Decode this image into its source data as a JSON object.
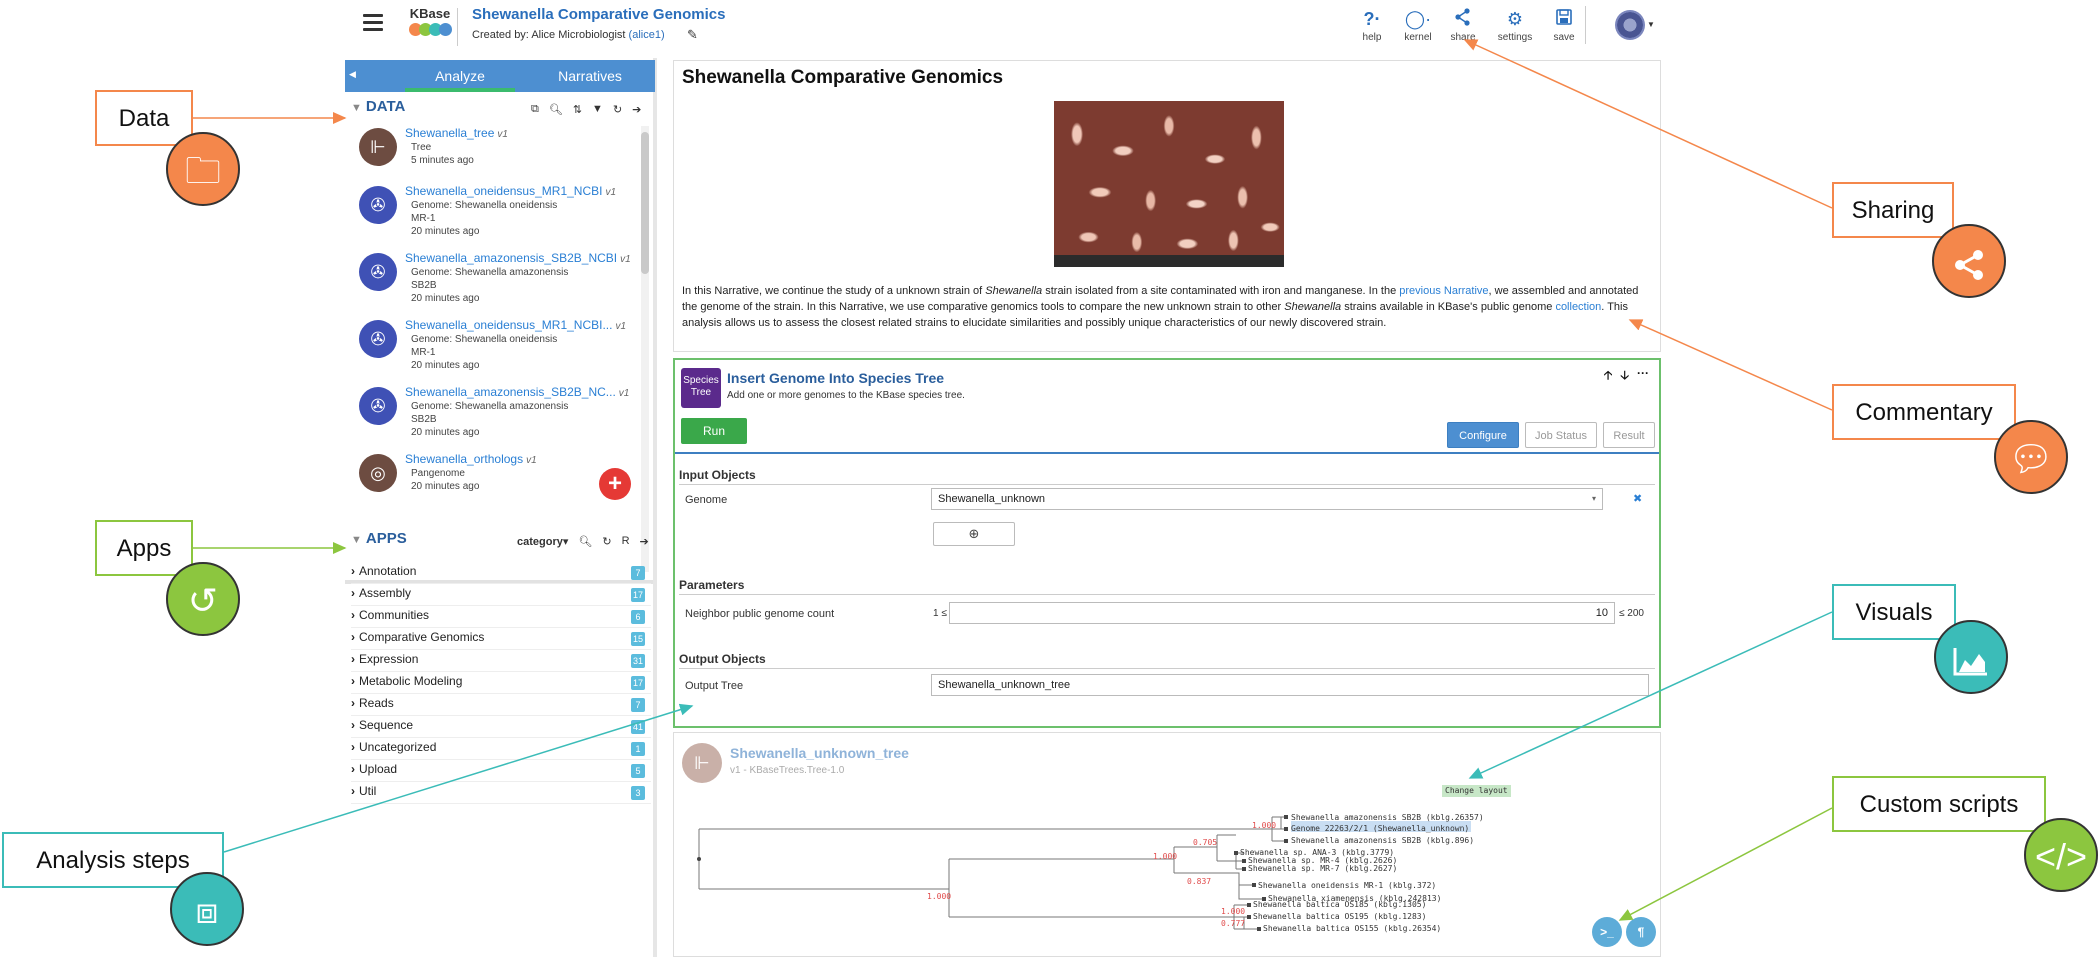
{
  "header": {
    "logo_text": "KBase",
    "title": "Shewanella Comparative Genomics",
    "created_by_label": "Created by:",
    "creator_name": "Alice Microbiologist",
    "creator_user": "(alice1)",
    "buttons": [
      {
        "label": "help",
        "icon": "question-icon"
      },
      {
        "label": "kernel",
        "icon": "kernel-icon"
      },
      {
        "label": "share",
        "icon": "share-icon"
      },
      {
        "label": "settings",
        "icon": "gear-icon"
      },
      {
        "label": "save",
        "icon": "save-icon"
      }
    ]
  },
  "sidebar": {
    "tabs": [
      "Analyze",
      "Narratives"
    ],
    "data_header": "DATA",
    "data_items": [
      {
        "name": "Shewanella_tree",
        "version": "v1",
        "type": "Tree",
        "subtitle": "",
        "time": "5 minutes ago",
        "icon": "tree-icon",
        "color": "#6d4c41"
      },
      {
        "name": "Shewanella_oneidensus_MR1_NCBI",
        "version": "v1",
        "type": "Genome: Shewanella oneidensis",
        "subtitle": "MR-1",
        "time": "20 minutes ago",
        "icon": "dna-icon",
        "color": "#3f51b5"
      },
      {
        "name": "Shewanella_amazonensis_SB2B_NCBI",
        "version": "v1",
        "type": "Genome: Shewanella amazonensis",
        "subtitle": "SB2B",
        "time": "20 minutes ago",
        "icon": "dna-icon",
        "color": "#3f51b5"
      },
      {
        "name": "Shewanella_oneidensus_MR1_NCBI...",
        "version": "v1",
        "type": "Genome: Shewanella oneidensis",
        "subtitle": "MR-1",
        "time": "20 minutes ago",
        "icon": "dna-icon",
        "color": "#3f51b5"
      },
      {
        "name": "Shewanella_amazonensis_SB2B_NC...",
        "version": "v1",
        "type": "Genome: Shewanella amazonensis",
        "subtitle": "SB2B",
        "time": "20 minutes ago",
        "icon": "dna-icon",
        "color": "#3f51b5"
      },
      {
        "name": "Shewanella_orthologs",
        "version": "v1",
        "type": "Pangenome",
        "subtitle": "",
        "time": "20 minutes ago",
        "icon": "pangenome-icon",
        "color": "#6d4c41"
      }
    ],
    "apps_header": "APPS",
    "apps_category_label": "category",
    "apps_filter_label": "R",
    "app_categories": [
      {
        "label": "Annotation",
        "count": "7"
      },
      {
        "label": "Assembly",
        "count": "17"
      },
      {
        "label": "Communities",
        "count": "6"
      },
      {
        "label": "Comparative Genomics",
        "count": "15"
      },
      {
        "label": "Expression",
        "count": "31"
      },
      {
        "label": "Metabolic Modeling",
        "count": "17"
      },
      {
        "label": "Reads",
        "count": "7"
      },
      {
        "label": "Sequence",
        "count": "41"
      },
      {
        "label": "Uncategorized",
        "count": "1"
      },
      {
        "label": "Upload",
        "count": "5"
      },
      {
        "label": "Util",
        "count": "3"
      }
    ]
  },
  "markdown_cell": {
    "title": "Shewanella Comparative Genomics",
    "p1": "In this Narrative, we continue the study of a unknown strain of",
    "p1_italic": "Shewanella",
    "p2": "strain isolated from a site contaminated with iron and manganese. In the",
    "link1": "previous Narrative",
    "p3": ", we assembled and annotated the genome of the strain. In this Narrative, we use comparative genomics tools to compare the new unknown strain to other",
    "p3_italic": "Shewanella",
    "p4": "strains available in KBase's public genome",
    "link2": "collection",
    "p5": ". This analysis allows us to assess the closest related strains to elucidate similarities and possibly unique characteristics of our newly discovered strain."
  },
  "app_cell": {
    "icon_text": "Species Tree",
    "title": "Insert Genome Into Species Tree",
    "subtitle": "Add one or more genomes to the KBase species tree.",
    "run_label": "Run",
    "tabs": [
      "Configure",
      "Job Status",
      "Result"
    ],
    "input_group": "Input Objects",
    "genome_label": "Genome",
    "genome_value": "Shewanella_unknown",
    "params_group": "Parameters",
    "neighbor_label": "Neighbor public genome count",
    "neighbor_min": "1 ≤",
    "neighbor_value": "10",
    "neighbor_max": "≤ 200",
    "output_group": "Output Objects",
    "output_label": "Output Tree",
    "output_value": "Shewanella_unknown_tree"
  },
  "output_cell": {
    "title": "Shewanella_unknown_tree",
    "subtitle": "v1 - KBaseTrees.Tree-1.0",
    "change_layout": "Change layout",
    "tree_labels": [
      "Shewanella amazonensis SB2B (kblg.26357)",
      "Genome 22263/2/1 (Shewanella_unknown)",
      "Shewanella amazonensis SB2B (kblg.896)",
      "Shewanella sp. ANA-3 (kblg.3779)",
      "Shewanella sp. MR-4 (kblg.2626)",
      "Shewanella sp. MR-7 (kblg.2627)",
      "Shewanella oneidensis MR-1 (kblg.372)",
      "Shewanella xiamenensis (kblg.242813)",
      "Shewanella baltica OS185 (kblg.1305)",
      "Shewanella baltica OS195 (kblg.1283)",
      "Shewanella baltica OS155 (kblg.26354)"
    ],
    "support_values": [
      "1.000",
      "0.705",
      "1.000",
      "0.837",
      "1.000",
      "1.000",
      "0.777"
    ]
  },
  "callouts": {
    "data": "Data",
    "apps": "Apps",
    "analysis_steps": "Analysis steps",
    "sharing": "Sharing",
    "commentary": "Commentary",
    "visuals": "Visuals",
    "custom_scripts": "Custom scripts"
  },
  "colors": {
    "orange": "#f4874b",
    "green": "#8cc63f",
    "teal": "#3bbcb8",
    "link_blue": "#2a7fd4",
    "header_blue": "#4d8fd1"
  }
}
